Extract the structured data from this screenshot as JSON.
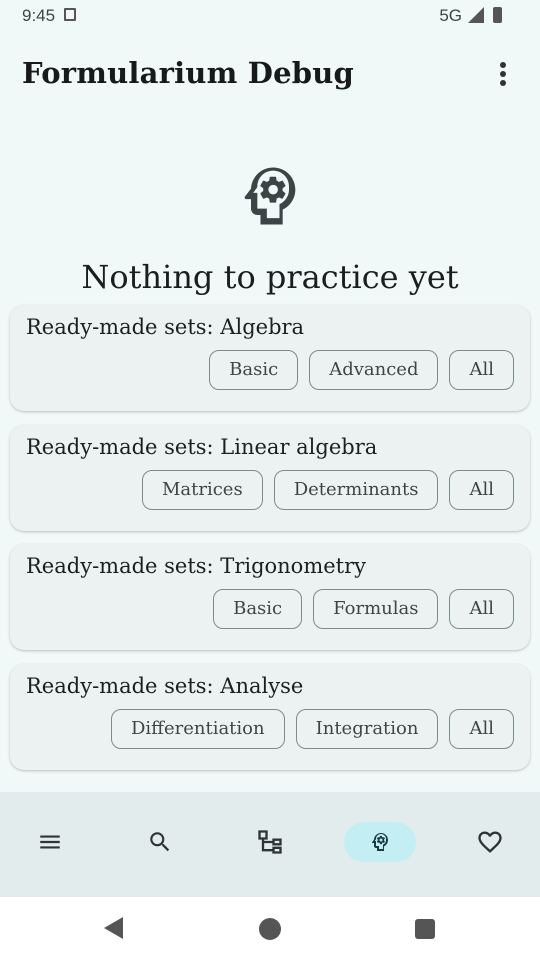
{
  "status_bar": {
    "time": "9:45",
    "network": "5G"
  },
  "app_bar": {
    "title": "Formularium Debug"
  },
  "empty_state": {
    "icon": "head-gear-icon",
    "title": "Nothing to practice yet"
  },
  "cards": [
    {
      "title": "Ready-made sets: Algebra",
      "chips": [
        "Basic",
        "Advanced",
        "All"
      ]
    },
    {
      "title": "Ready-made sets: Linear algebra",
      "chips": [
        "Matrices",
        "Determinants",
        "All"
      ]
    },
    {
      "title": "Ready-made sets: Trigonometry",
      "chips": [
        "Basic",
        "Formulas",
        "All"
      ]
    },
    {
      "title": "Ready-made sets: Analyse",
      "chips": [
        "Differentiation",
        "Integration",
        "All"
      ]
    }
  ],
  "bottom_nav": {
    "items": [
      {
        "icon": "menu-icon",
        "active": false
      },
      {
        "icon": "search-icon",
        "active": false
      },
      {
        "icon": "hierarchy-icon",
        "active": false
      },
      {
        "icon": "head-gear-icon",
        "active": true
      },
      {
        "icon": "heart-icon",
        "active": false
      }
    ]
  },
  "colors": {
    "background": "#f1f8f8",
    "card": "#ecf2f2",
    "nav_bar": "#e3ecec",
    "active_indicator": "#c3eef4"
  }
}
